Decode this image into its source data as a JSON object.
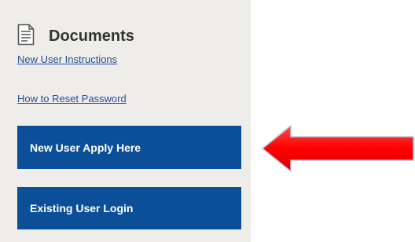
{
  "documents": {
    "title": "Documents",
    "icon": "document-icon",
    "links": {
      "new_user_instructions": "New User Instructions",
      "reset_password": "How to Reset Password"
    }
  },
  "buttons": {
    "apply_label": "New User Apply Here",
    "login_label": "Existing User Login"
  },
  "colors": {
    "sidebar_bg": "#efedea",
    "button_bg": "#0b4f99",
    "link": "#1f4f9a",
    "arrow": "#ff0000"
  },
  "annotation": {
    "icon": "red-arrow-left-icon"
  }
}
